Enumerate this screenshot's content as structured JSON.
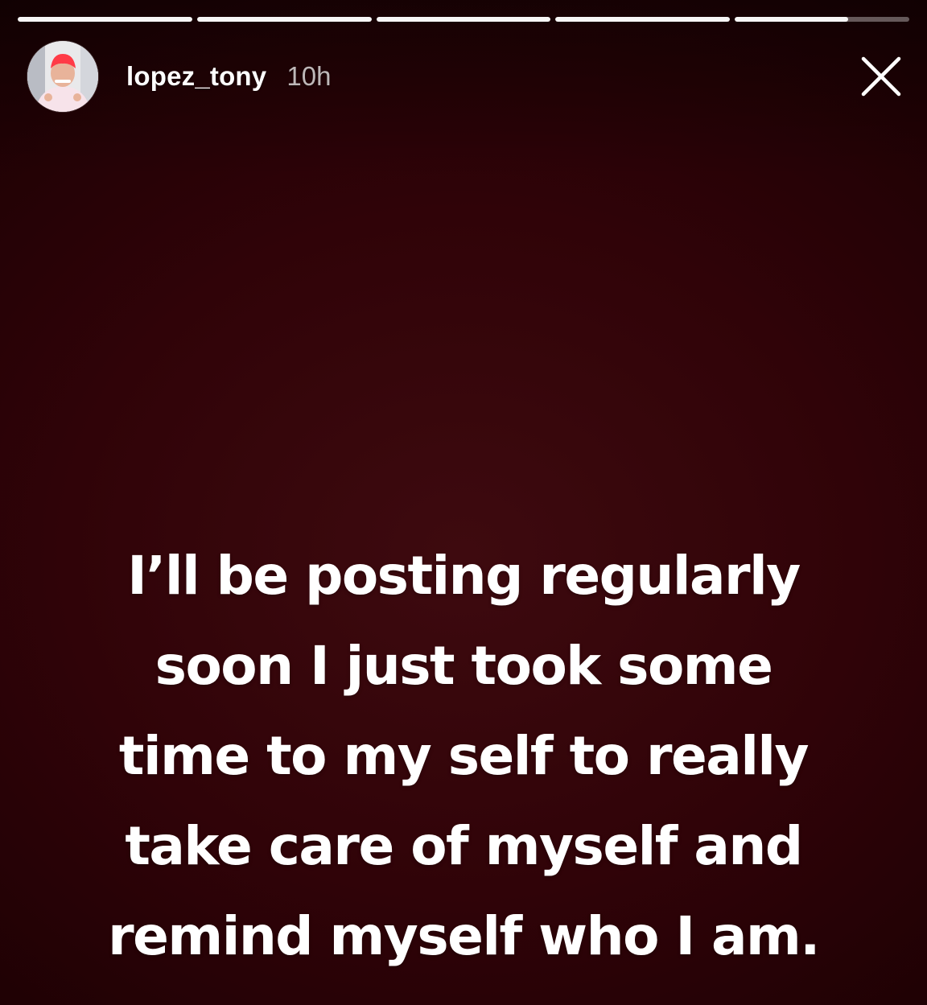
{
  "story": {
    "progress": {
      "segments": [
        1,
        1,
        1,
        1,
        0.65
      ]
    },
    "user": {
      "username": "lopez_tony",
      "time_ago": "10h",
      "avatar_icon": "profile-photo"
    },
    "close_icon": "close-icon",
    "text_lines": [
      "I’ll be posting regularly",
      "soon I just took some",
      "time to my self to really",
      "take care of myself and",
      "remind myself who I am."
    ],
    "colors": {
      "background": "#300308",
      "text": "#ffffff"
    }
  }
}
